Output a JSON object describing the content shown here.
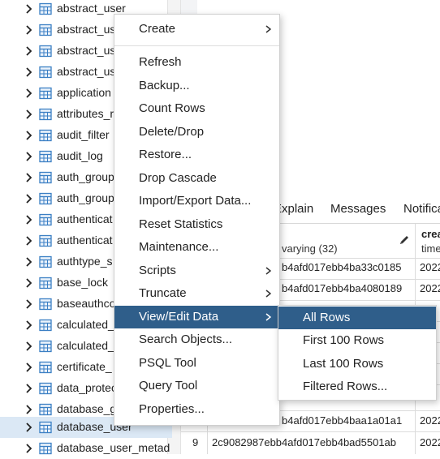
{
  "tree": {
    "items": [
      {
        "label": "abstract_user"
      },
      {
        "label": "abstract_us"
      },
      {
        "label": "abstract_us"
      },
      {
        "label": "abstract_us"
      },
      {
        "label": "application"
      },
      {
        "label": "attributes_r"
      },
      {
        "label": "audit_filter"
      },
      {
        "label": "audit_log"
      },
      {
        "label": "auth_group"
      },
      {
        "label": "auth_group"
      },
      {
        "label": "authenticat"
      },
      {
        "label": "authenticat"
      },
      {
        "label": "authtype_s"
      },
      {
        "label": "base_lock"
      },
      {
        "label": "baseauthco"
      },
      {
        "label": "calculated_"
      },
      {
        "label": "calculated_"
      },
      {
        "label": "certificate_"
      },
      {
        "label": "data_protec"
      },
      {
        "label": "database_g"
      },
      {
        "label": "database_user",
        "selected": true
      },
      {
        "label": "database_user_metad"
      }
    ]
  },
  "panel": {
    "tabs": [
      "Explain",
      "Messages",
      "Notifica"
    ],
    "grid": {
      "col1_type": "varying (32)",
      "col2_name": "crea",
      "col2_type": "time",
      "rows": [
        {
          "num": "",
          "id": "b4afd017ebb4ba33c0185",
          "created": "2022"
        },
        {
          "num": "",
          "id": "b4afd017ebb4ba4080189",
          "created": "2022"
        },
        {
          "num": "",
          "id": "",
          "created": ""
        },
        {
          "num": "",
          "id": "",
          "created": ""
        },
        {
          "num": "",
          "id": "",
          "created": ""
        },
        {
          "num": "",
          "id": "b4afd017ebb4baa1a01a1",
          "created": "2022"
        },
        {
          "num": "9",
          "id": "2c9082987ebb4afd017ebb4bad5501ab",
          "created": "2022"
        }
      ]
    }
  },
  "context_menu": {
    "items": [
      {
        "label": "Create",
        "submenu": true
      },
      {
        "label": "Refresh"
      },
      {
        "label": "Backup..."
      },
      {
        "label": "Count Rows"
      },
      {
        "label": "Delete/Drop"
      },
      {
        "label": "Restore..."
      },
      {
        "label": "Drop Cascade"
      },
      {
        "label": "Import/Export Data..."
      },
      {
        "label": "Reset Statistics"
      },
      {
        "label": "Maintenance..."
      },
      {
        "label": "Scripts",
        "submenu": true
      },
      {
        "label": "Truncate",
        "submenu": true
      },
      {
        "label": "View/Edit Data",
        "submenu": true,
        "active": true
      },
      {
        "label": "Search Objects..."
      },
      {
        "label": "PSQL Tool"
      },
      {
        "label": "Query Tool"
      },
      {
        "label": "Properties..."
      }
    ]
  },
  "submenu": {
    "items": [
      {
        "label": "All Rows",
        "active": true
      },
      {
        "label": "First 100 Rows"
      },
      {
        "label": "Last 100 Rows"
      },
      {
        "label": "Filtered Rows..."
      }
    ]
  },
  "colors": {
    "accent": "#2f5e8a",
    "selected_row": "#dbe8f5",
    "table_icon": "#3b7fc4"
  },
  "icons": {
    "tree_expand": "chevron-right-icon",
    "table": "table-icon",
    "edit": "pencil-icon",
    "submenu": "caret-right-icon"
  }
}
